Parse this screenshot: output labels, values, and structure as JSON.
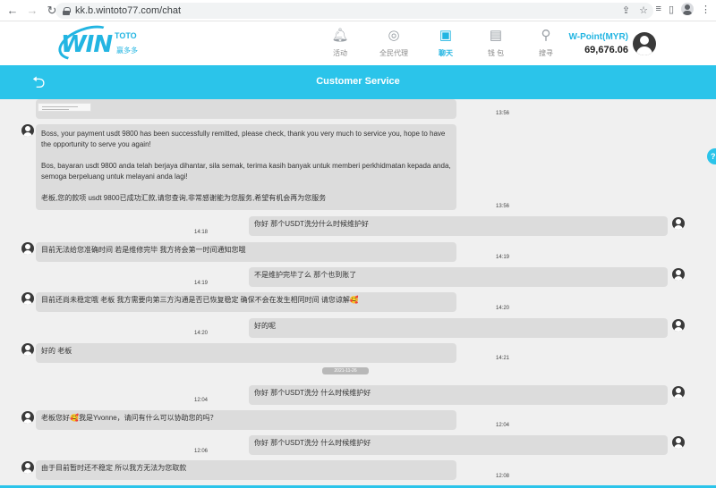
{
  "browser": {
    "url": "kk.b.wintoto77.com/chat",
    "back_icon": "arrow-left-icon",
    "forward_icon": "arrow-right-icon",
    "reload_icon": "reload-icon"
  },
  "header": {
    "logo_text": "WIN",
    "logo_sub": "TOTO",
    "logo_cn": "赢多多",
    "nav": [
      {
        "label": "活动",
        "icon": "bell-icon",
        "active": false
      },
      {
        "label": "全民代理",
        "icon": "agent-icon",
        "active": false
      },
      {
        "label": "聊天",
        "icon": "chat-icon",
        "active": true
      },
      {
        "label": "钱 包",
        "icon": "wallet-icon",
        "active": false
      },
      {
        "label": "搜寻",
        "icon": "search-icon",
        "active": false
      }
    ],
    "wpoint_label": "W-Point(MYR)",
    "wpoint_value": "69,676.06"
  },
  "titlebar": {
    "title": "Customer Service"
  },
  "chat": {
    "date_divider": "2021-11-26",
    "messages": [
      {
        "side": "left",
        "text": "",
        "time": "13:56",
        "image": true
      },
      {
        "side": "left",
        "paragraphs": [
          "Boss, your payment usdt 9800 has been successfully remitted, please check, thank you very much to service you, hope to have the opportunity to serve you again!",
          "Bos, bayaran usdt 9800 anda telah berjaya dihantar, sila semak, terima kasih banyak untuk memberi perkhidmatan kepada anda, semoga berpeluang untuk melayani anda lagi!",
          "老板,您的款项 usdt 9800已成功汇款,请您查询,非常感谢能为您服务,希望有机会再为您服务"
        ],
        "time": "13:56"
      },
      {
        "side": "right",
        "text": "你好  那个USDT洗分什么时候维护好",
        "time": "14:18"
      },
      {
        "side": "left",
        "text": "目前无法给您准确时间 若是维修完毕 我方将会第一时间通知您哦",
        "time": "14:19"
      },
      {
        "side": "right",
        "text": "不是维护完毕了么  那个也到账了",
        "time": "14:19"
      },
      {
        "side": "left",
        "text": "目前还尚未稳定哦 老板 我方需要向第三方沟通是否已恢复稳定 确保不会在发生相同时间 请您谅解🥰",
        "time": "14:20"
      },
      {
        "side": "right",
        "text": "好的呢",
        "time": "14:20"
      },
      {
        "side": "left",
        "text": "好的 老板",
        "time": "14:21"
      },
      {
        "side": "right",
        "text": "你好  那个USDT洗分 什么时候维护好",
        "time": "12:04"
      },
      {
        "side": "left",
        "text": "老板您好🥰我是Yvonne，请问有什么可以协助您的吗？",
        "time": "12:04"
      },
      {
        "side": "right",
        "text": "你好  那个USDT洗分 什么时候维护好",
        "time": "12:06"
      },
      {
        "side": "left",
        "text": "由于目前暂时还不稳定 所以我方无法为您取款",
        "time": "12:08"
      }
    ]
  },
  "colors": {
    "accent": "#2bc4ea",
    "bubble": "#dcdcdc",
    "chat_bg": "#f0f0f0"
  }
}
